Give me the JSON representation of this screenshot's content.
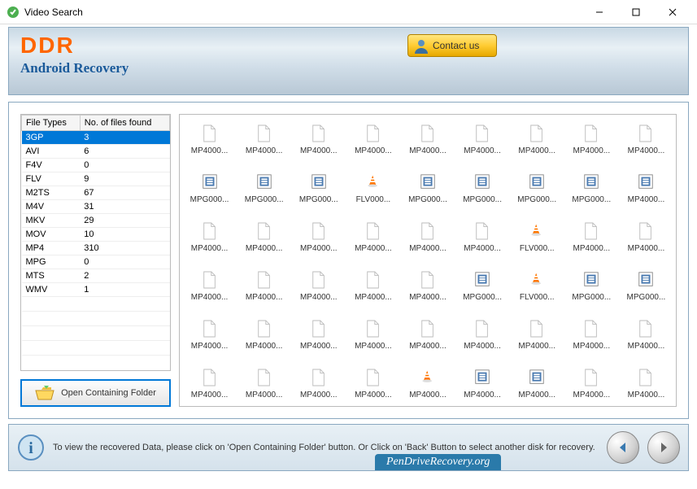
{
  "window": {
    "title": "Video Search"
  },
  "branding": {
    "line1": "DDR",
    "line2": "Android Recovery"
  },
  "contact": {
    "label": "Contact us"
  },
  "table": {
    "headers": [
      "File Types",
      "No. of files found"
    ],
    "rows": [
      {
        "type": "3GP",
        "count": "3",
        "selected": true
      },
      {
        "type": "AVI",
        "count": "6"
      },
      {
        "type": "F4V",
        "count": "0"
      },
      {
        "type": "FLV",
        "count": "9"
      },
      {
        "type": "M2TS",
        "count": "67"
      },
      {
        "type": "M4V",
        "count": "31"
      },
      {
        "type": "MKV",
        "count": "29"
      },
      {
        "type": "MOV",
        "count": "10"
      },
      {
        "type": "MP4",
        "count": "310"
      },
      {
        "type": "MPG",
        "count": "0"
      },
      {
        "type": "MTS",
        "count": "2"
      },
      {
        "type": "WMV",
        "count": "1"
      }
    ],
    "empty_rows": 5
  },
  "open_folder_btn": "Open Containing Folder",
  "files_grid_rows": [
    [
      {
        "n": "MP4000...",
        "i": "blank"
      },
      {
        "n": "MP4000...",
        "i": "blank"
      },
      {
        "n": "MP4000...",
        "i": "blank"
      },
      {
        "n": "MP4000...",
        "i": "blank"
      },
      {
        "n": "MP4000...",
        "i": "blank"
      },
      {
        "n": "MP4000...",
        "i": "blank"
      },
      {
        "n": "MP4000...",
        "i": "blank"
      },
      {
        "n": "MP4000...",
        "i": "blank"
      },
      {
        "n": "MP4000...",
        "i": "blank"
      }
    ],
    [
      {
        "n": "MPG000...",
        "i": "mpg"
      },
      {
        "n": "MPG000...",
        "i": "mpg"
      },
      {
        "n": "MPG000...",
        "i": "mpg"
      },
      {
        "n": "FLV000...",
        "i": "vlc"
      },
      {
        "n": "MPG000...",
        "i": "mpg"
      },
      {
        "n": "MPG000...",
        "i": "mpg"
      },
      {
        "n": "MPG000...",
        "i": "mpg"
      },
      {
        "n": "MPG000...",
        "i": "mpg"
      },
      {
        "n": "MP4000...",
        "i": "mpg"
      }
    ],
    [
      {
        "n": "MP4000...",
        "i": "blank"
      },
      {
        "n": "MP4000...",
        "i": "blank"
      },
      {
        "n": "MP4000...",
        "i": "blank"
      },
      {
        "n": "MP4000...",
        "i": "blank"
      },
      {
        "n": "MP4000...",
        "i": "blank"
      },
      {
        "n": "MP4000...",
        "i": "blank"
      },
      {
        "n": "FLV000...",
        "i": "vlc"
      },
      {
        "n": "MP4000...",
        "i": "blank"
      },
      {
        "n": "MP4000...",
        "i": "blank"
      }
    ],
    [
      {
        "n": "MP4000...",
        "i": "blank"
      },
      {
        "n": "MP4000...",
        "i": "blank"
      },
      {
        "n": "MP4000...",
        "i": "blank"
      },
      {
        "n": "MP4000...",
        "i": "blank"
      },
      {
        "n": "MP4000...",
        "i": "blank"
      },
      {
        "n": "MPG000...",
        "i": "mpg"
      },
      {
        "n": "FLV000...",
        "i": "vlc"
      },
      {
        "n": "MPG000...",
        "i": "mpg"
      },
      {
        "n": "MPG000...",
        "i": "mpg"
      }
    ],
    [
      {
        "n": "MP4000...",
        "i": "blank"
      },
      {
        "n": "MP4000...",
        "i": "blank"
      },
      {
        "n": "MP4000...",
        "i": "blank"
      },
      {
        "n": "MP4000...",
        "i": "blank"
      },
      {
        "n": "MP4000...",
        "i": "blank"
      },
      {
        "n": "MP4000...",
        "i": "blank"
      },
      {
        "n": "MP4000...",
        "i": "blank"
      },
      {
        "n": "MP4000...",
        "i": "blank"
      },
      {
        "n": "MP4000...",
        "i": "blank"
      }
    ],
    [
      {
        "n": "MP4000...",
        "i": "blank"
      },
      {
        "n": "MP4000...",
        "i": "blank"
      },
      {
        "n": "MP4000...",
        "i": "blank"
      },
      {
        "n": "MP4000...",
        "i": "blank"
      },
      {
        "n": "MP4000...",
        "i": "vlc"
      },
      {
        "n": "MP4000...",
        "i": "mpg"
      },
      {
        "n": "MP4000...",
        "i": "mpg"
      },
      {
        "n": "MP4000...",
        "i": "blank"
      },
      {
        "n": "MP4000...",
        "i": "blank"
      }
    ]
  ],
  "footer": {
    "text": "To view the recovered Data, please click on 'Open Containing Folder' button. Or Click on 'Back' Button to select another disk for recovery."
  },
  "watermark": "PenDriveRecovery.org"
}
